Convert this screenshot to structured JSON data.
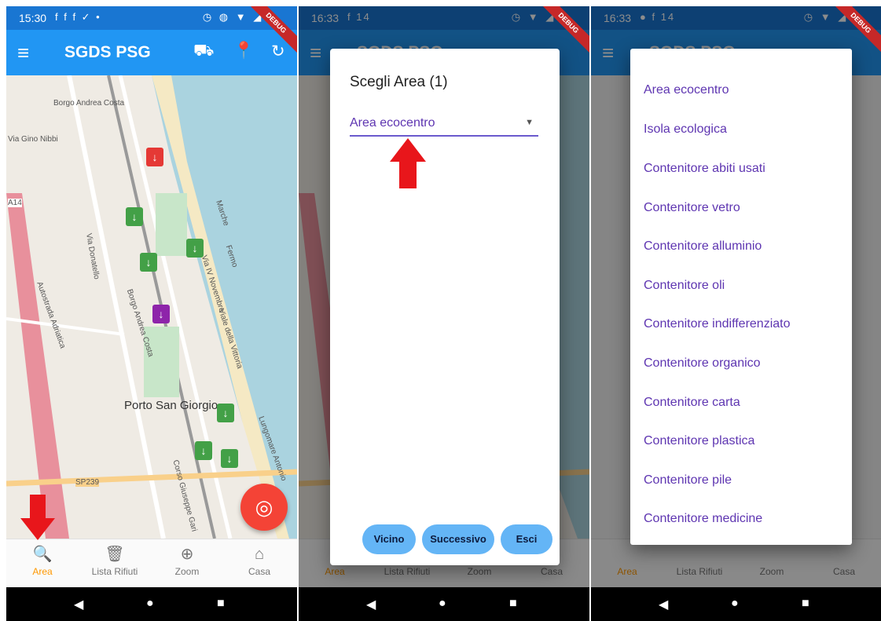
{
  "theme": {
    "primary": "#2196f3",
    "status_bar": "#1976d2",
    "accent": "#ff9800",
    "fab": "#f44336",
    "marker_green": "#43a047",
    "marker_red": "#e53935",
    "marker_purple": "#8e24aa",
    "dropdown_text": "#5e35b1",
    "button_bg": "#64b5f6",
    "arrow": "#e8161b"
  },
  "screen1": {
    "status": {
      "time": "15:30",
      "left_icons": "f f f ✓ •",
      "right_icons": "◷ ◍ ▼ ◢ ▮",
      "debug": "DEBUG"
    },
    "appbar": {
      "title": "SGDS PSG",
      "menu_icon": "≡",
      "car_icon": "⛟",
      "pin_icon": "📍",
      "refresh_icon": "↻"
    },
    "map_labels": {
      "l1": "Borgo Andrea Costa",
      "l2": "Via Gino Nibbi",
      "l3": "A14",
      "l4": "Autostrada Adriatica",
      "l5": "Via Donatello",
      "l6": "Borgo Andrea Costa",
      "l7": "Porto San Giorgio",
      "l8": "SP239",
      "l9": "Corso Giuseppe Gari",
      "l10": "Lungomare Antonio",
      "l11": "Marche",
      "l12": "Fermo",
      "l13": "Via IV Novembre",
      "l14": "Viale della Vittoria"
    },
    "nav": [
      {
        "label": "Area",
        "icon": "🔍"
      },
      {
        "label": "Lista Rifiuti",
        "icon": "🗑"
      },
      {
        "label": "Zoom",
        "icon": "⊕"
      },
      {
        "label": "Casa",
        "icon": "⌂"
      }
    ],
    "fab_icon": "◎"
  },
  "screen2": {
    "status": {
      "time": "16:33",
      "left_icons": "f 14",
      "right_icons": "◷ ▼ ◢ ▮",
      "debug": "DEBUG"
    },
    "appbar": {
      "title": "SGDS PSG"
    },
    "dialog": {
      "title": "Scegli Area (1)",
      "selected": "Area ecocentro",
      "caret": "▼",
      "buttons": {
        "near": "Vicino",
        "next": "Successivo",
        "exit": "Esci"
      }
    },
    "nav": [
      {
        "label": "Area"
      },
      {
        "label": "Lista Rifiuti"
      },
      {
        "label": "Zoom"
      },
      {
        "label": "Casa"
      }
    ]
  },
  "screen3": {
    "status": {
      "time": "16:33",
      "left_icons": "● f 14",
      "right_icons": "◷ ▼ ◢ ▮",
      "debug": "DEBUG"
    },
    "appbar": {
      "title": "SGDS PSG"
    },
    "options": [
      "Area ecocentro",
      "Isola ecologica",
      "Contenitore abiti usati",
      "Contenitore vetro",
      "Contenitore alluminio",
      "Contenitore oli",
      "Contenitore indifferenziato",
      "Contenitore organico",
      "Contenitore carta",
      "Contenitore plastica",
      "Contenitore pile",
      "Contenitore medicine"
    ],
    "nav": [
      {
        "label": "Area"
      },
      {
        "label": "Lista Rifiuti"
      },
      {
        "label": "Zoom"
      },
      {
        "label": "Casa"
      }
    ]
  },
  "sysnav": {
    "back": "◀",
    "home": "●",
    "recent": "■"
  }
}
